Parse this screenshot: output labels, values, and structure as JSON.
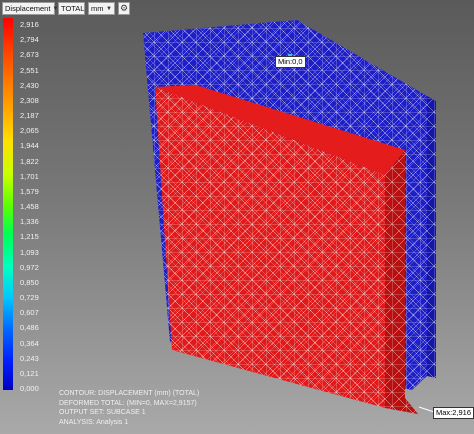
{
  "toolbar": {
    "result_type": "Displacement",
    "component": "TOTAL",
    "unit": "mm",
    "settings_icon": "gear-icon"
  },
  "legend": {
    "values": [
      "2,916",
      "2,794",
      "2,673",
      "2,551",
      "2,430",
      "2,308",
      "2,187",
      "2,065",
      "1,944",
      "1,822",
      "1,701",
      "1,579",
      "1,458",
      "1,336",
      "1,215",
      "1,093",
      "0,972",
      "0,850",
      "0,729",
      "0,607",
      "0,486",
      "0,364",
      "0,243",
      "0,121",
      "0,000"
    ],
    "colors": {
      "max": "#ff0000",
      "min": "#0000c0"
    }
  },
  "info": {
    "line1": "CONTOUR: DISPLACEMENT (mm) (TOTAL)",
    "line2": "DEFORMED TOTAL: (MIN=0, MAX=2,9157)",
    "line3": "OUTPUT SET: SUBCASE 1",
    "line4": "ANALYSIS: Analysis 1"
  },
  "probes": {
    "min": "Min:0,0",
    "max": "Max:2,916"
  },
  "model": {
    "back_plate_color": "#1f1fc8",
    "front_plate_color": "#e01a1a",
    "side_face_color": "#b81010",
    "mesh_color": "#ffffff"
  }
}
